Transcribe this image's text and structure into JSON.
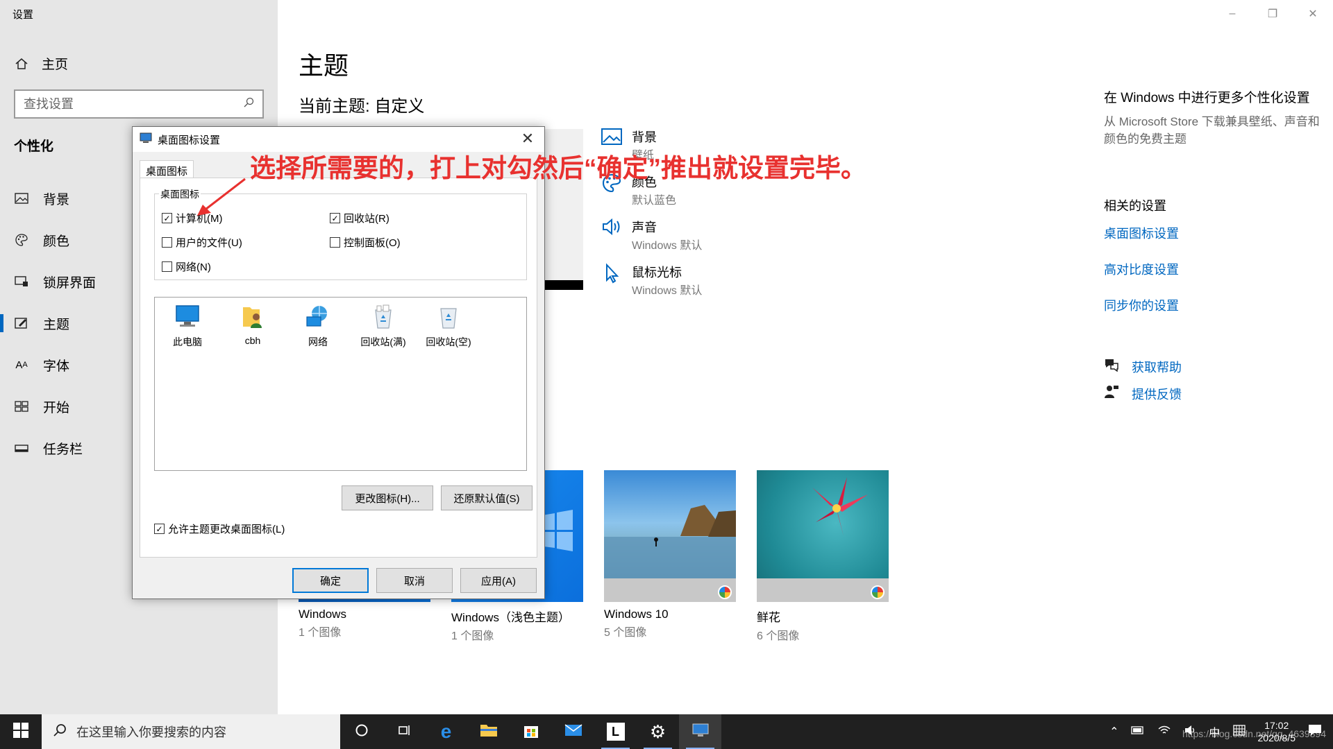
{
  "app_title": "设置",
  "sidebar": {
    "home_label": "主页",
    "search_placeholder": "查找设置",
    "section_title": "个性化",
    "items": [
      {
        "label": "背景"
      },
      {
        "label": "颜色"
      },
      {
        "label": "锁屏界面"
      },
      {
        "label": "主题"
      },
      {
        "label": "字体"
      },
      {
        "label": "开始"
      },
      {
        "label": "任务栏"
      }
    ],
    "active_item": "主题"
  },
  "main": {
    "page_title": "主题",
    "current_theme": "当前主题: 自定义",
    "properties": [
      {
        "title": "背景",
        "subtitle": "壁纸",
        "icon": "picture-icon"
      },
      {
        "title": "颜色",
        "subtitle": "默认蓝色",
        "icon": "palette-icon"
      },
      {
        "title": "声音",
        "subtitle": "Windows 默认",
        "icon": "speaker-icon"
      },
      {
        "title": "鼠标光标",
        "subtitle": "Windows 默认",
        "icon": "cursor-icon"
      }
    ],
    "themes": [
      {
        "name": "Windows",
        "count": "1 个图像"
      },
      {
        "name": "Windows（浅色主题）",
        "count": "1 个图像"
      },
      {
        "name": "Windows 10",
        "count": "5 个图像"
      },
      {
        "name": "鲜花",
        "count": "6 个图像"
      }
    ]
  },
  "right_panel": {
    "title": "在 Windows 中进行更多个性化设置",
    "description": "从 Microsoft Store 下载兼具壁纸、声音和颜色的免费主题",
    "related_title": "相关的设置",
    "links": [
      "桌面图标设置",
      "高对比度设置",
      "同步你的设置"
    ],
    "help": "获取帮助",
    "feedback": "提供反馈"
  },
  "dialog": {
    "title": "桌面图标设置",
    "tab": "桌面图标",
    "group_label": "桌面图标",
    "checkboxes": {
      "computer": {
        "label": "计算机(M)",
        "checked": true
      },
      "recycle": {
        "label": "回收站(R)",
        "checked": true
      },
      "user_files": {
        "label": "用户的文件(U)",
        "checked": false
      },
      "control_panel": {
        "label": "控制面板(O)",
        "checked": false
      },
      "network": {
        "label": "网络(N)",
        "checked": false
      }
    },
    "icons": [
      "此电脑",
      "cbh",
      "网络",
      "回收站(满)",
      "回收站(空)"
    ],
    "change_icon": "更改图标(H)...",
    "restore_default": "还原默认值(S)",
    "allow_themes": {
      "label": "允许主题更改桌面图标(L)",
      "checked": true
    },
    "ok": "确定",
    "cancel": "取消",
    "apply": "应用(A)"
  },
  "annotation": "选择所需要的，打上对勾然后“确定”推出就设置完毕。",
  "taskbar": {
    "search_placeholder": "在这里输入你要搜索的内容",
    "time": "17:02",
    "date": "2020/8/5",
    "ime": "中",
    "watermark": "https://blog.csdn.net/qq_4639894"
  },
  "colors": {
    "accent": "#0067c0",
    "annotation": "#e8312f",
    "taskbar": "#202020"
  }
}
